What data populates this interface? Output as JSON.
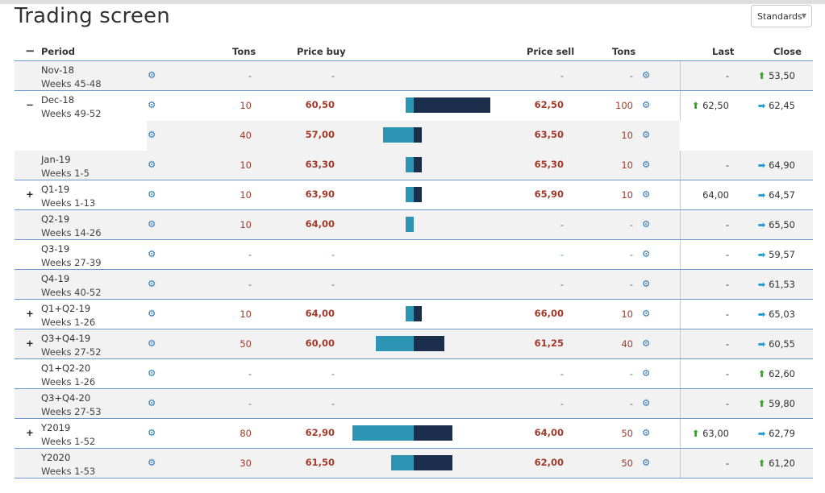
{
  "title": "Trading screen",
  "selector": {
    "value": "Standards",
    "caret_icon": "caret-down-icon"
  },
  "headers": {
    "expand": "−",
    "period": "Period",
    "tons_buy": "Tons",
    "price_buy": "Price buy",
    "price_sell": "Price sell",
    "tons_sell": "Tons",
    "last": "Last",
    "close": "Close"
  },
  "colors": {
    "buy_bar": "#2c95b4",
    "sell_bar": "#1b2f4d",
    "price": "#a23a2a",
    "gear": "#2e77b8",
    "up_arrow": "#3aa629",
    "right_arrow": "#2a9ad6"
  },
  "glyphs": {
    "gear": "⚙",
    "up": "⬆",
    "right": "➡"
  },
  "rows": [
    {
      "expand": "",
      "name": "Nov-18",
      "weeks": "Weeks 45-48",
      "tons_buy": "-",
      "price_buy": "-",
      "price_sell": "-",
      "tons_sell": "-",
      "last": "-",
      "last_arrow": "",
      "close": "53,50",
      "close_arrow": "up",
      "buy_bar": 0,
      "sell_bar": 0
    },
    {
      "expand": "−",
      "name": "Dec-18",
      "weeks": "Weeks 49-52",
      "tons_buy": "10",
      "price_buy": "60,50",
      "price_sell": "62,50",
      "tons_sell": "100",
      "last": "62,50",
      "last_arrow": "up",
      "close": "62,45",
      "close_arrow": "right",
      "buy_bar": 10,
      "sell_bar": 100
    },
    {
      "sub": true,
      "expand": "",
      "name": "",
      "weeks": "",
      "tons_buy": "40",
      "price_buy": "57,00",
      "price_sell": "63,50",
      "tons_sell": "10",
      "last": "",
      "last_arrow": "",
      "close": "",
      "close_arrow": "",
      "buy_bar": 40,
      "sell_bar": 10
    },
    {
      "expand": "",
      "name": "Jan-19",
      "weeks": "Weeks 1-5",
      "tons_buy": "10",
      "price_buy": "63,30",
      "price_sell": "65,30",
      "tons_sell": "10",
      "last": "-",
      "last_arrow": "",
      "close": "64,90",
      "close_arrow": "right",
      "buy_bar": 10,
      "sell_bar": 10
    },
    {
      "expand": "+",
      "name": "Q1-19",
      "weeks": "Weeks 1-13",
      "tons_buy": "10",
      "price_buy": "63,90",
      "price_sell": "65,90",
      "tons_sell": "10",
      "last": "64,00",
      "last_arrow": "",
      "close": "64,57",
      "close_arrow": "right",
      "buy_bar": 10,
      "sell_bar": 10
    },
    {
      "expand": "",
      "name": "Q2-19",
      "weeks": "Weeks 14-26",
      "tons_buy": "10",
      "price_buy": "64,00",
      "price_sell": "-",
      "tons_sell": "-",
      "last": "-",
      "last_arrow": "",
      "close": "65,50",
      "close_arrow": "right",
      "buy_bar": 10,
      "sell_bar": 0
    },
    {
      "expand": "",
      "name": "Q3-19",
      "weeks": "Weeks 27-39",
      "tons_buy": "-",
      "price_buy": "-",
      "price_sell": "-",
      "tons_sell": "-",
      "last": "-",
      "last_arrow": "",
      "close": "59,57",
      "close_arrow": "right",
      "buy_bar": 0,
      "sell_bar": 0,
      "blue_dash": true
    },
    {
      "expand": "",
      "name": "Q4-19",
      "weeks": "Weeks 40-52",
      "tons_buy": "-",
      "price_buy": "-",
      "price_sell": "-",
      "tons_sell": "-",
      "last": "-",
      "last_arrow": "",
      "close": "61,53",
      "close_arrow": "right",
      "buy_bar": 0,
      "sell_bar": 0
    },
    {
      "expand": "+",
      "name": "Q1+Q2-19",
      "weeks": "Weeks 1-26",
      "tons_buy": "10",
      "price_buy": "64,00",
      "price_sell": "66,00",
      "tons_sell": "10",
      "last": "-",
      "last_arrow": "",
      "close": "65,03",
      "close_arrow": "right",
      "buy_bar": 10,
      "sell_bar": 10
    },
    {
      "expand": "+",
      "name": "Q3+Q4-19",
      "weeks": "Weeks 27-52",
      "tons_buy": "50",
      "price_buy": "60,00",
      "price_sell": "61,25",
      "tons_sell": "40",
      "last": "-",
      "last_arrow": "",
      "close": "60,55",
      "close_arrow": "right",
      "buy_bar": 50,
      "sell_bar": 40
    },
    {
      "expand": "",
      "name": "Q1+Q2-20",
      "weeks": "Weeks 1-26",
      "tons_buy": "-",
      "price_buy": "-",
      "price_sell": "-",
      "tons_sell": "-",
      "last": "-",
      "last_arrow": "",
      "close": "62,60",
      "close_arrow": "up",
      "buy_bar": 0,
      "sell_bar": 0
    },
    {
      "expand": "",
      "name": "Q3+Q4-20",
      "weeks": "Weeks 27-53",
      "tons_buy": "-",
      "price_buy": "-",
      "price_sell": "-",
      "tons_sell": "-",
      "last": "-",
      "last_arrow": "",
      "close": "59,80",
      "close_arrow": "up",
      "buy_bar": 0,
      "sell_bar": 0
    },
    {
      "expand": "+",
      "name": "Y2019",
      "weeks": "Weeks 1-52",
      "tons_buy": "80",
      "price_buy": "62,90",
      "price_sell": "64,00",
      "tons_sell": "50",
      "last": "63,00",
      "last_arrow": "up",
      "close": "62,79",
      "close_arrow": "right",
      "buy_bar": 80,
      "sell_bar": 50
    },
    {
      "expand": "",
      "name": "Y2020",
      "weeks": "Weeks 1-53",
      "tons_buy": "30",
      "price_buy": "61,50",
      "price_sell": "62,00",
      "tons_sell": "50",
      "last": "-",
      "last_arrow": "",
      "close": "61,20",
      "close_arrow": "up",
      "buy_bar": 30,
      "sell_bar": 50
    }
  ]
}
